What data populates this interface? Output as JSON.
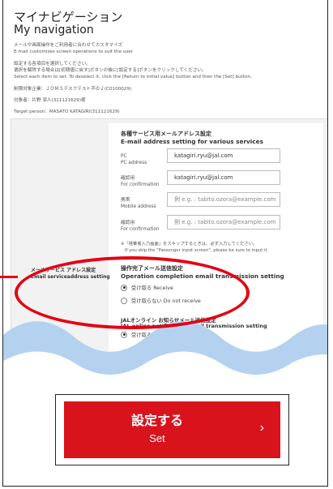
{
  "header": {
    "title_jp": "マイナビゲーション",
    "title_en": "My navigation",
    "desc_jp": "メールや画面操作をご利用者に合わせてカスタマイズ",
    "desc_en": "E-mail customizes screen operations to suit the user",
    "instr_jp1": "設定する各項目を選択してください。",
    "instr_jp2": "選択を解除する場合は[初期値に戻す]ボタンの後に[設定する]ボタンをクリックしてください。",
    "instr_en": "Select each item to set. To deselect it, click the [Return to initial value] button and then the [Set] button.",
    "target_set": "制限対象企業：ＪＯＭＳデスクテスト不の２(C0100029)",
    "target_person_jp": "対象者：片野 潔人(311121629)様",
    "target_person_en": "Target person：MASATO KATAGIRI(311121629)"
  },
  "email_section": {
    "heading_jp": "各種サービス用メールアドレス設定",
    "heading_en": "E-mail address setting for various services",
    "fields": [
      {
        "label_jp": "PC",
        "label_en": "PC address",
        "value": "katagiri.ryu@jal.com",
        "placeholder": ""
      },
      {
        "label_jp": "確認用",
        "label_en": "For confirmation",
        "value": "katagiri.ryu@jal.com",
        "placeholder": ""
      },
      {
        "label_jp": "携帯",
        "label_en": "Mobile address",
        "value": "",
        "placeholder": "例 e.g. : tabito.ozora@example.com"
      },
      {
        "label_jp": "確認用",
        "label_en": "For confirmation",
        "value": "",
        "placeholder": "例 e.g. : tabito.ozora@example.com"
      }
    ],
    "note_jp": "※「搭乗者入力画面」をスキップするときは、必ず入力してください。",
    "note_en": "If you skip the \"Passenger input screen\", please be sure to input it."
  },
  "op_section": {
    "left_label_jp": "メールサービス アドレス設定",
    "left_label_en": "Email serviceaddress setting",
    "heading_jp": "操作完了メール送信設定",
    "heading_en": "Operation completion email transmission setting",
    "options": [
      {
        "label": "受け取る Receive",
        "selected": true
      },
      {
        "label": "受け取らない Do not receive",
        "selected": false
      }
    ]
  },
  "online_section": {
    "heading_jp": "JALオンライン お知らせメール送信設定",
    "heading_en": "JAL online notification email transmission setting",
    "option_label": "受け取る Receive"
  },
  "set_button": {
    "label_jp": "設定する",
    "label_en": "Set",
    "chevron": "›"
  },
  "colors": {
    "accent": "#e50012",
    "button": "#d8131c",
    "wave": "#b4d2f0"
  }
}
